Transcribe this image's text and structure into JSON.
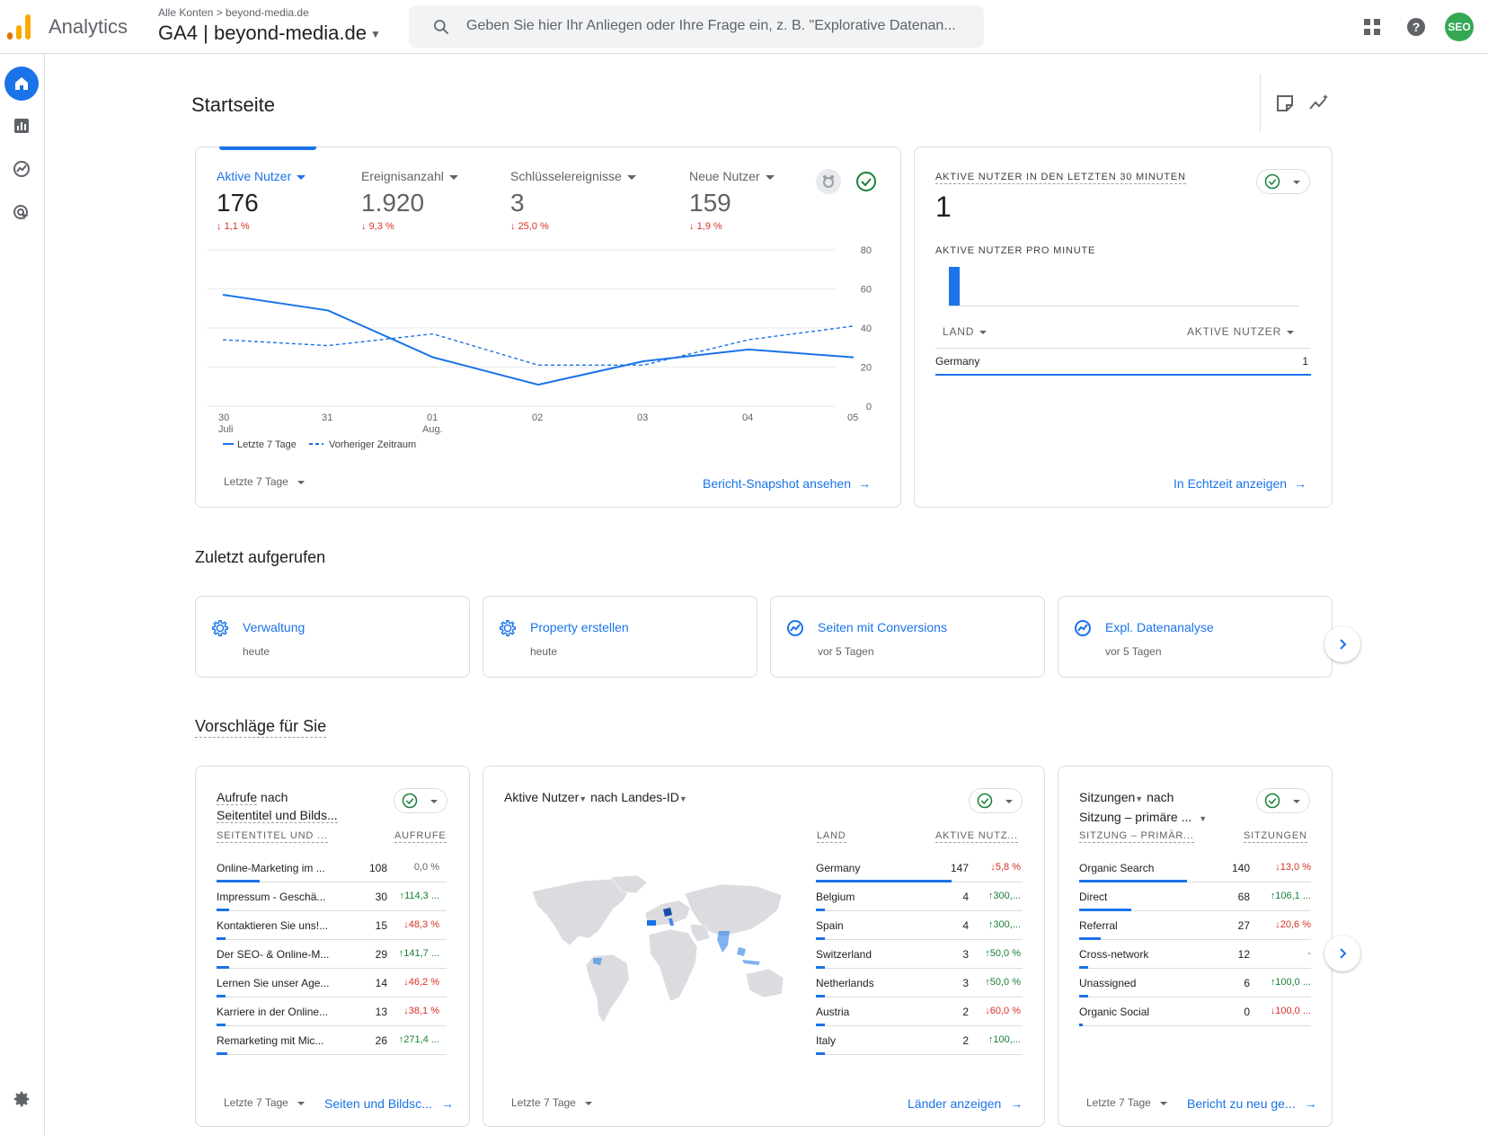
{
  "topbar": {
    "app_name": "Analytics",
    "breadcrumb": "Alle Konten > beyond-media.de",
    "property": "GA4 | beyond-media.de",
    "search_placeholder": "Geben Sie hier Ihr Anliegen oder Ihre Frage ein, z. B. \"Explorative Datenan...",
    "avatar": "SEO",
    "colors": {
      "accent": "#1a73e8",
      "avatar": "#34a853",
      "logo_orange": "#f9ab00",
      "logo_dark": "#e37400"
    }
  },
  "leftnav": {
    "items": [
      "home-icon",
      "reports-icon",
      "explore-icon",
      "advertising-icon"
    ],
    "settings": "gear-icon"
  },
  "page": {
    "title": "Startseite"
  },
  "overview": {
    "metrics": [
      {
        "label": "Aktive Nutzer",
        "value": "176",
        "delta": "1,1 %"
      },
      {
        "label": "Ereignisanzahl",
        "value": "1.920",
        "delta": "9,3 %"
      },
      {
        "label": "Schlüsselereignisse",
        "value": "3",
        "delta": "25,0 %"
      },
      {
        "label": "Neue Nutzer",
        "value": "159",
        "delta": "1,9 %"
      }
    ],
    "legend_current": "Letzte 7 Tage",
    "legend_previous": "Vorheriger Zeitraum",
    "date_range": "Letzte 7 Tage",
    "link": "Bericht-Snapshot ansehen"
  },
  "chart_data": {
    "type": "line",
    "categories": [
      "30 Juli",
      "31",
      "01 Aug.",
      "02",
      "03",
      "04",
      "05"
    ],
    "x_labels": [
      [
        "30",
        "Juli"
      ],
      [
        "31",
        ""
      ],
      [
        "01",
        "Aug."
      ],
      [
        "02",
        ""
      ],
      [
        "03",
        ""
      ],
      [
        "04",
        ""
      ],
      [
        "05",
        ""
      ]
    ],
    "series": [
      {
        "name": "Letzte 7 Tage",
        "values": [
          57,
          49,
          25,
          11,
          23,
          29,
          25
        ]
      },
      {
        "name": "Vorheriger Zeitraum",
        "values": [
          34,
          31,
          37,
          21,
          21,
          34,
          41
        ]
      }
    ],
    "yticks": [
      "80",
      "60",
      "40",
      "20",
      "0"
    ],
    "ylim": [
      0,
      80
    ],
    "grid": true,
    "legend": "bottom-left"
  },
  "realtime": {
    "title": "AKTIVE NUTZER IN DEN LETZTEN 30 MINUTEN",
    "value": "1",
    "per_minute_label": "AKTIVE NUTZER PRO MINUTE",
    "per_minute": [
      1
    ],
    "col_country": "LAND",
    "col_users": "AKTIVE NUTZER",
    "rows": [
      {
        "country": "Germany",
        "users": "1"
      }
    ],
    "link": "In Echtzeit anzeigen"
  },
  "recent": {
    "title": "Zuletzt aufgerufen",
    "items": [
      {
        "title": "Verwaltung",
        "sub": "heute",
        "icon": "gear-icon"
      },
      {
        "title": "Property erstellen",
        "sub": "heute",
        "icon": "gear-icon"
      },
      {
        "title": "Seiten mit Conversions",
        "sub": "vor 5 Tagen",
        "icon": "report-trend-icon"
      },
      {
        "title": "Expl. Datenanalyse",
        "sub": "vor 5 Tagen",
        "icon": "explore-icon"
      }
    ]
  },
  "suggestions": {
    "title": "Vorschläge für Sie",
    "pages": {
      "title_u1": "Aufrufe",
      "title_rest1": " nach",
      "title_u2": "Seitentitel und Bilds...",
      "col1": "SEITENTITEL UND ...",
      "col2": "AUFRUFE",
      "rows": [
        {
          "name": "Online-Marketing im ...",
          "value": "108",
          "change": "0,0 %",
          "dir": "neutral",
          "share": 0.24
        },
        {
          "name": "Impressum - Geschä...",
          "value": "30",
          "change": "114,3 ...",
          "dir": "up",
          "share": 0.07
        },
        {
          "name": "Kontaktieren Sie uns!...",
          "value": "15",
          "change": "48,3 %",
          "dir": "down",
          "share": 0.04
        },
        {
          "name": "Der SEO- & Online-M...",
          "value": "29",
          "change": "141,7 ...",
          "dir": "up",
          "share": 0.07
        },
        {
          "name": "Lernen Sie unser Age...",
          "value": "14",
          "change": "46,2 %",
          "dir": "down",
          "share": 0.03
        },
        {
          "name": "Karriere in der Online...",
          "value": "13",
          "change": "38,1 %",
          "dir": "down",
          "share": 0.03
        },
        {
          "name": "Remarketing mit Mic...",
          "value": "26",
          "change": "271,4 ...",
          "dir": "up",
          "share": 0.06
        }
      ],
      "date_range": "Letzte 7 Tage",
      "link": "Seiten und Bildsc..."
    },
    "countries": {
      "title_metric": "Aktive Nutzer",
      "title_mid": "nach",
      "title_dim": "Landes-ID",
      "col1": "LAND",
      "col2": "AKTIVE NUTZ...",
      "rows": [
        {
          "name": "Germany",
          "value": "147",
          "change": "5,8 %",
          "dir": "down",
          "share": 0.84
        },
        {
          "name": "Belgium",
          "value": "4",
          "change": "300,...",
          "dir": "up",
          "share": 0.03
        },
        {
          "name": "Spain",
          "value": "4",
          "change": "300,...",
          "dir": "up",
          "share": 0.03
        },
        {
          "name": "Switzerland",
          "value": "3",
          "change": "50,0 %",
          "dir": "up",
          "share": 0.02
        },
        {
          "name": "Netherlands",
          "value": "3",
          "change": "50,0 %",
          "dir": "up",
          "share": 0.02
        },
        {
          "name": "Austria",
          "value": "2",
          "change": "60,0 %",
          "dir": "down",
          "share": 0.01
        },
        {
          "name": "Italy",
          "value": "2",
          "change": "100,...",
          "dir": "up",
          "share": 0.01
        }
      ],
      "date_range": "Letzte 7 Tage",
      "link": "Länder anzeigen"
    },
    "sessions": {
      "title_metric": "Sitzungen",
      "title_mid": "nach",
      "title_dim": "Sitzung – primäre ...",
      "col1": "SITZUNG – PRIMÄR...",
      "col2": "SITZUNGEN",
      "rows": [
        {
          "name": "Organic Search",
          "value": "140",
          "change": "13,0 %",
          "dir": "down",
          "share": 0.6
        },
        {
          "name": "Direct",
          "value": "68",
          "change": "106,1 ...",
          "dir": "up",
          "share": 0.29
        },
        {
          "name": "Referral",
          "value": "27",
          "change": "20,6 %",
          "dir": "down",
          "share": 0.12
        },
        {
          "name": "Cross-network",
          "value": "12",
          "change": "-",
          "dir": "neutral",
          "share": 0.05
        },
        {
          "name": "Unassigned",
          "value": "6",
          "change": "100,0 ...",
          "dir": "up",
          "share": 0.03
        },
        {
          "name": "Organic Social",
          "value": "0",
          "change": "100,0 ...",
          "dir": "down",
          "share": 0.0
        }
      ],
      "date_range": "Letzte 7 Tage",
      "link": "Bericht zu neu ge..."
    }
  }
}
